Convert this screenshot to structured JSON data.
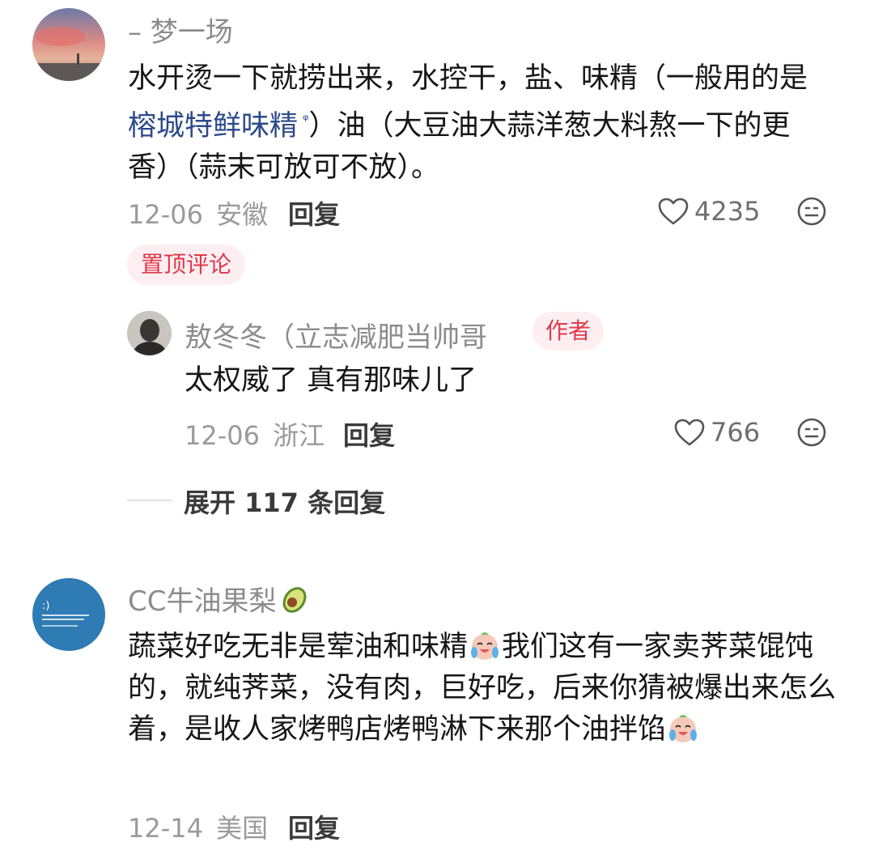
{
  "comments": [
    {
      "username": "– 梦一场",
      "text_before_link": "水开烫一下就捞出来，水控干，盐、味精（一般用的是 ",
      "link_text": "榕城特鲜味精",
      "link_icon": "search-superscript-icon",
      "text_after_link": "）油（大豆油大蒜洋葱大料熬一下的更香）（蒜末可放可不放）。",
      "date": "12-06",
      "location": "安徽",
      "reply_label": "回复",
      "likes": "4235",
      "pinned_label": "置顶评论",
      "reply": {
        "username": "敖冬冬（立志减肥当帅哥",
        "author_badge": "作者",
        "text": "太权威了 真有那味儿了",
        "date": "12-06",
        "location": "浙江",
        "reply_label": "回复",
        "likes": "766"
      },
      "expand_label": "展开 117 条回复"
    },
    {
      "username": "CC牛油果梨",
      "username_emoji": "avocado-icon",
      "text_part1": "蔬菜好吃无非是荤油和味精",
      "emoji_1": "crying-laughing-emoji",
      "text_part2": "我们这有一家卖荠菜馄饨的，就纯荠菜，没有肉，巨好吃，后来你猜被爆出来怎么着，是收人家烤鸭店烤鸭淋下来那个油拌馅",
      "emoji_2": "crying-laughing-emoji",
      "date": "12-14",
      "location": "美国",
      "reply_label": "回复"
    }
  ],
  "colors": {
    "pinned_bg": "#fdeff1",
    "pinned_text": "#e0384b",
    "link": "#2d4a8a",
    "meta": "#9a9a9a"
  }
}
